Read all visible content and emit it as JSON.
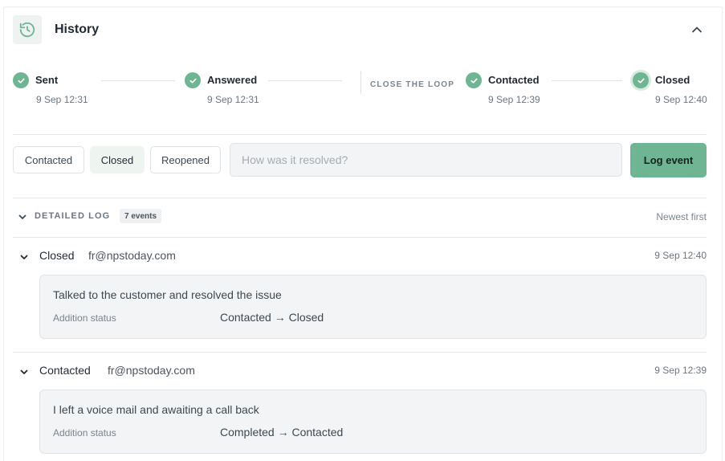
{
  "header": {
    "title": "History",
    "icon": "history-icon",
    "collapse_icon": "chevron-up-icon"
  },
  "stepper": {
    "steps": [
      {
        "label": "Sent",
        "time": "9 Sep 12:31"
      },
      {
        "label": "Answered",
        "time": "9 Sep 12:31"
      },
      {
        "label": "Contacted",
        "time": "9 Sep 12:39"
      },
      {
        "label": "Closed",
        "time": "9 Sep 12:40"
      }
    ],
    "close_the_loop_label": "CLOSE THE LOOP"
  },
  "actions": {
    "options": [
      "Contacted",
      "Closed",
      "Reopened"
    ],
    "selected": "Closed",
    "input_placeholder": "How was it resolved?",
    "input_value": "",
    "submit_label": "Log event"
  },
  "detailed_log": {
    "title": "DETAILED LOG",
    "count": "7 events",
    "sort_label": "Newest first",
    "events": [
      {
        "status": "Closed",
        "user": "fr@npstoday.com",
        "time": "9 Sep 12:40",
        "note": "Talked to the customer and resolved the issue",
        "addition_label": "Addition status",
        "transition": "Contacted → Closed"
      },
      {
        "status": "Contacted",
        "user": "fr@npstoday.com",
        "time": "9 Sep 12:39",
        "note": "I left a voice mail and awaiting a call back",
        "addition_label": "Addition status",
        "transition": "Completed → Contacted"
      }
    ]
  },
  "colors": {
    "accent": "#6fb593",
    "accent_light": "#eef5f1",
    "text": "#1f2a33",
    "muted": "#7a848c"
  }
}
